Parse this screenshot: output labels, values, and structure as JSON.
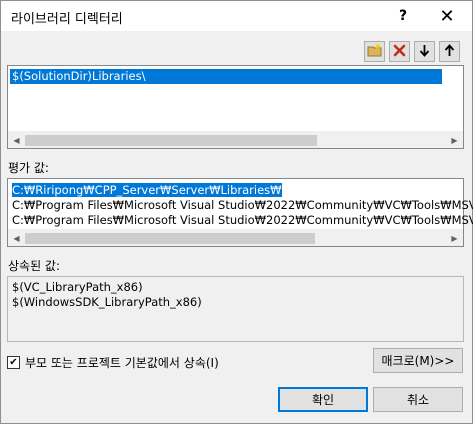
{
  "window": {
    "title": "라이브러리 디렉터리",
    "help_label": "?",
    "close_label": "✕"
  },
  "toolbar": {
    "icons": [
      "new-folder-icon",
      "delete-icon",
      "move-down-icon",
      "move-up-icon"
    ],
    "delete_color": "#c42b1c"
  },
  "directory_list": {
    "items": [
      "$(SolutionDir)Libraries\\"
    ]
  },
  "evaluated": {
    "label": "평가 값:",
    "lines": [
      "C:₩Riripong₩CPP_Server₩Server₩Libraries₩",
      "C:₩Program Files₩Microsoft Visual Studio₩2022₩Community₩VC₩Tools₩MSV",
      "C:₩Program Files₩Microsoft Visual Studio₩2022₩Community₩VC₩Tools₩MSV"
    ]
  },
  "inherited": {
    "label": "상속된 값:",
    "lines": [
      "$(VC_LibraryPath_x86)",
      "$(WindowsSDK_LibraryPath_x86)"
    ]
  },
  "options": {
    "inherit_label": "부모 또는 프로젝트 기본값에서 상속(I)",
    "inherit_checked": true,
    "macros_label": "매크로(M)>>"
  },
  "footer": {
    "ok_label": "확인",
    "cancel_label": "취소"
  },
  "colors": {
    "selection": "#0078d7",
    "default_button_border": "#0078d7"
  }
}
